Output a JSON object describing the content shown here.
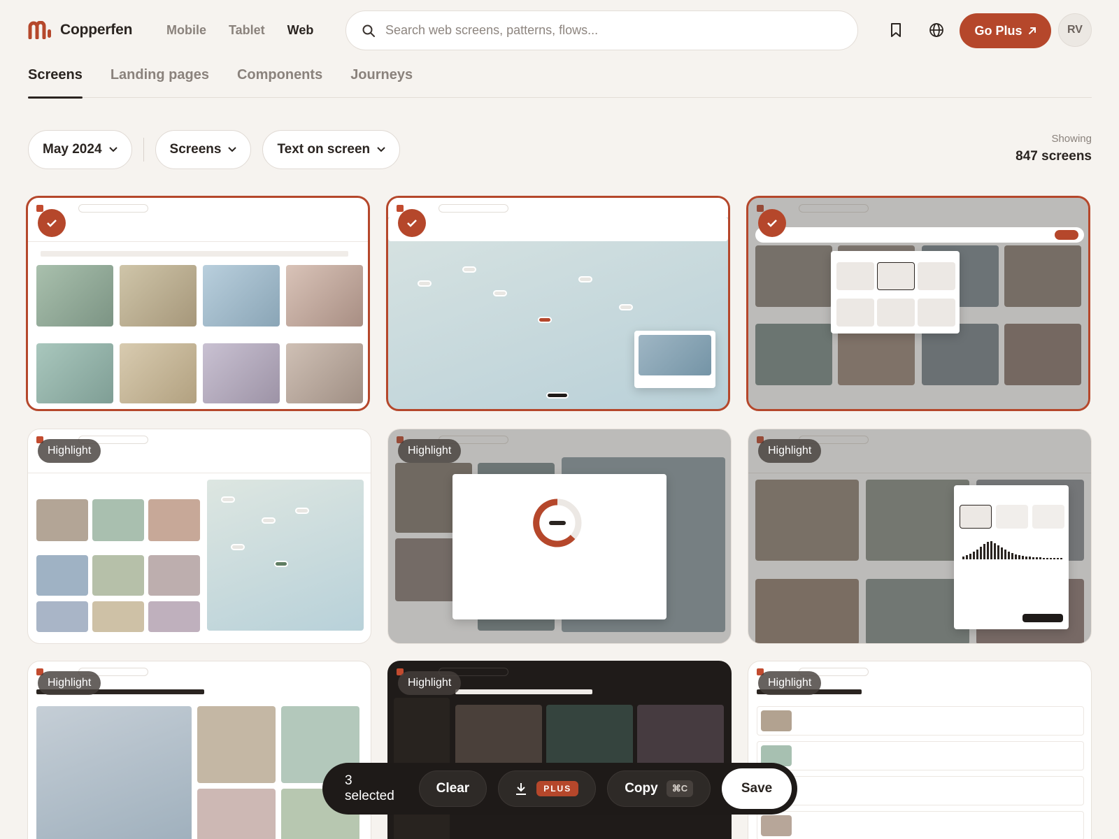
{
  "brand": {
    "name": "Copperfen",
    "accent": "#b5472b"
  },
  "platforms": [
    {
      "label": "Mobile",
      "active": false
    },
    {
      "label": "Tablet",
      "active": false
    },
    {
      "label": "Web",
      "active": true
    }
  ],
  "search": {
    "placeholder": "Search web screens, patterns, flows...",
    "value": "",
    "icon": "search-icon"
  },
  "header_actions": {
    "bookmark_icon": "bookmark-icon",
    "language_icon": "globe-icon",
    "go_plus_label": "Go Plus",
    "go_plus_icon": "arrow-up-right-icon",
    "avatar_initials": "RV"
  },
  "tabs": [
    {
      "label": "Screens",
      "active": true
    },
    {
      "label": "Landing pages",
      "active": false
    },
    {
      "label": "Components",
      "active": false
    },
    {
      "label": "Journeys",
      "active": false
    }
  ],
  "filters": [
    {
      "label": "May 2024"
    },
    {
      "label": "Screens"
    },
    {
      "label": "Text on screen"
    }
  ],
  "showing": {
    "label": "Showing",
    "count": "847 screens"
  },
  "cards": [
    {
      "selected": true,
      "badge": ""
    },
    {
      "selected": true,
      "badge": ""
    },
    {
      "selected": true,
      "badge": ""
    },
    {
      "selected": false,
      "badge": "Highlight"
    },
    {
      "selected": false,
      "badge": "Highlight"
    },
    {
      "selected": false,
      "badge": "Highlight"
    },
    {
      "selected": false,
      "badge": "Highlight"
    },
    {
      "selected": false,
      "badge": "Highlight"
    },
    {
      "selected": false,
      "badge": "Highlight"
    }
  ],
  "selection_bar": {
    "count": "3 selected",
    "clear_label": "Clear",
    "download_icon": "download-icon",
    "download_badge": "PLUS",
    "copy_label": "Copy",
    "copy_shortcut": "⌘C",
    "save_label": "Save"
  }
}
